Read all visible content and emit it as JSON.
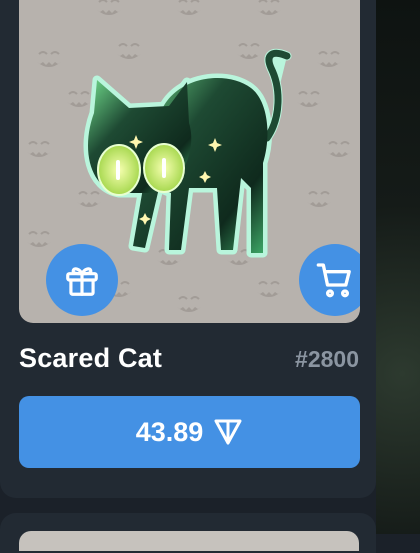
{
  "item": {
    "title": "Scared Cat",
    "number": "#2800",
    "price": "43.89",
    "currency_icon": "ton-icon"
  },
  "actions": {
    "gift_icon": "gift-icon",
    "cart_icon": "cart-icon"
  },
  "colors": {
    "accent": "#4491e4",
    "card": "#222a33",
    "background": "#1b2129",
    "pattern_bg": "#b7b2ad",
    "number_text": "#8b95a1"
  }
}
